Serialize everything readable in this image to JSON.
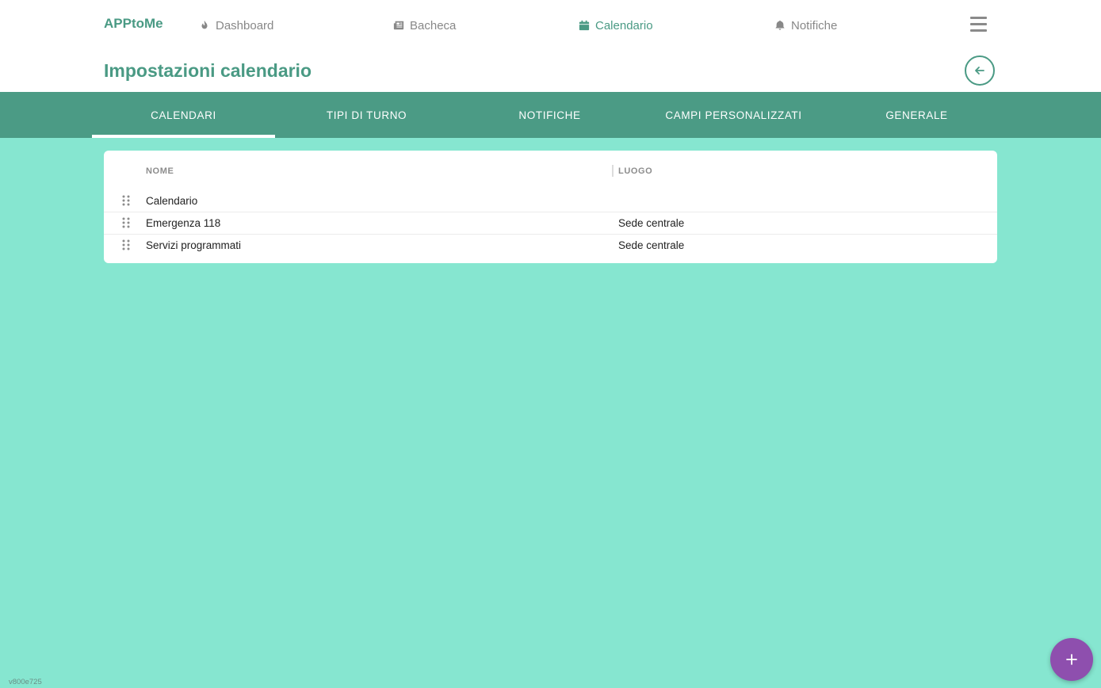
{
  "app": {
    "brand": "APPtoMe",
    "version": "v800e725"
  },
  "nav": {
    "items": [
      {
        "label": "Dashboard",
        "icon": "fire-icon",
        "active": false
      },
      {
        "label": "Bacheca",
        "icon": "newspaper-icon",
        "active": false
      },
      {
        "label": "Calendario",
        "icon": "calendar-icon",
        "active": true
      },
      {
        "label": "Notifiche",
        "icon": "bell-icon",
        "active": false
      }
    ],
    "menu_icon": "hamburger-icon"
  },
  "page": {
    "title": "Impostazioni calendario",
    "back_icon": "arrow-left-icon"
  },
  "tabs": [
    {
      "label": "CALENDARI",
      "active": true
    },
    {
      "label": "TIPI DI TURNO",
      "active": false
    },
    {
      "label": "NOTIFICHE",
      "active": false
    },
    {
      "label": "CAMPI PERSONALIZZATI",
      "active": false
    },
    {
      "label": "GENERALE",
      "active": false
    }
  ],
  "table": {
    "headers": {
      "name": "NOME",
      "location": "LUOGO"
    },
    "rows": [
      {
        "name": "Calendario",
        "location": ""
      },
      {
        "name": "Emergenza 118",
        "location": "Sede centrale"
      },
      {
        "name": "Servizi programmati",
        "location": "Sede centrale"
      }
    ]
  },
  "fab": {
    "icon": "plus-icon"
  },
  "colors": {
    "accent": "#4a9a84",
    "tabbar": "#4b9b85",
    "background": "#86e6d0",
    "fab": "#8e4fae"
  }
}
